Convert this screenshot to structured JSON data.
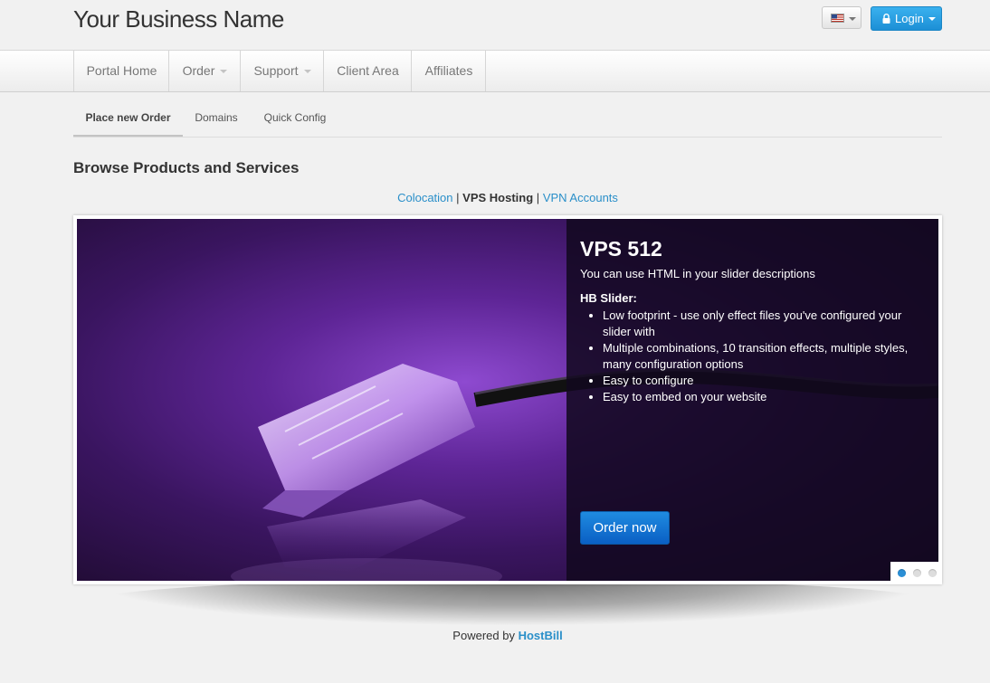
{
  "header": {
    "business_name": "Your Business Name",
    "language_icon": "us-flag-icon",
    "login_label": "Login"
  },
  "nav": {
    "items": [
      {
        "label": "Portal Home",
        "dropdown": false
      },
      {
        "label": "Order",
        "dropdown": true
      },
      {
        "label": "Support",
        "dropdown": true
      },
      {
        "label": "Client Area",
        "dropdown": false
      },
      {
        "label": "Affiliates",
        "dropdown": false
      }
    ]
  },
  "subtabs": {
    "items": [
      {
        "label": "Place new Order",
        "active": true
      },
      {
        "label": "Domains",
        "active": false
      },
      {
        "label": "Quick Config",
        "active": false
      }
    ]
  },
  "main": {
    "title": "Browse Products and Services",
    "categories": [
      {
        "label": "Colocation",
        "current": false
      },
      {
        "label": "VPS Hosting",
        "current": true
      },
      {
        "label": "VPN Accounts",
        "current": false
      }
    ],
    "separator": "|"
  },
  "slider": {
    "title": "VPS 512",
    "subtitle": "You can use HTML in your slider descriptions",
    "features_heading": "HB Slider:",
    "features": [
      "Low footprint - use only effect files you've configured your slider with",
      "Multiple combinations, 10 transition effects, multiple styles, many configuration options",
      "Easy to configure",
      "Easy to embed on your website"
    ],
    "order_label": "Order now",
    "slide_count": 3,
    "active_slide": 1
  },
  "footer": {
    "prefix": "Powered by",
    "brand": "HostBill"
  },
  "colors": {
    "accent": "#2a8fc9",
    "login_button": "#1c8fd6",
    "order_button": "#0a5fc4"
  }
}
